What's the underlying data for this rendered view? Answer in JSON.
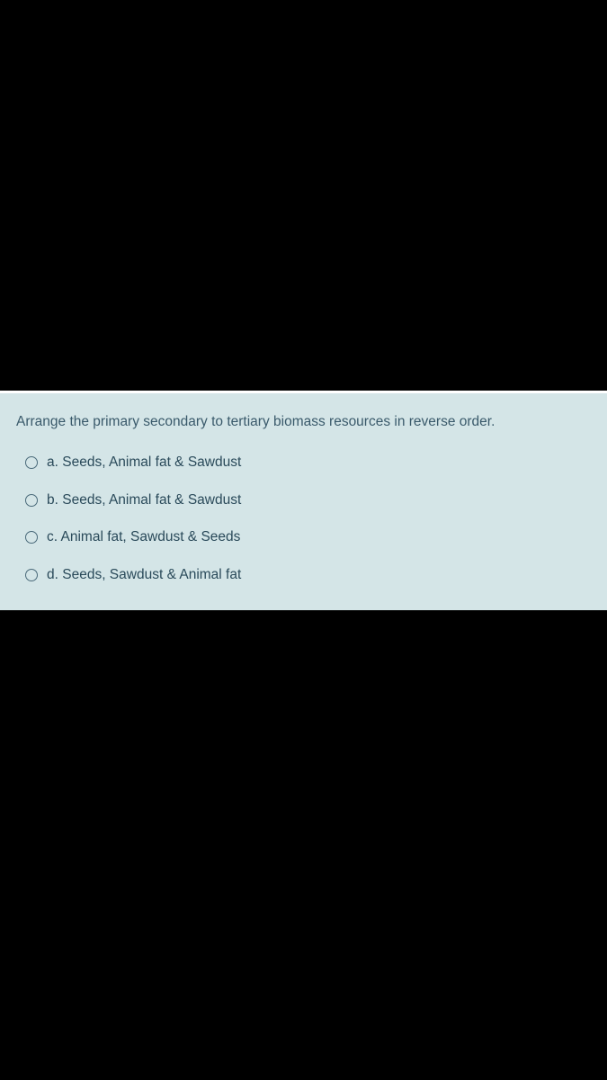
{
  "question": {
    "text": "Arrange the primary secondary to tertiary biomass resources in reverse order.",
    "options": [
      {
        "letter": "a.",
        "text": "Seeds, Animal fat & Sawdust"
      },
      {
        "letter": "b.",
        "text": "Seeds, Animal fat & Sawdust"
      },
      {
        "letter": "c.",
        "text": "Animal fat, Sawdust & Seeds"
      },
      {
        "letter": "d.",
        "text": "Seeds, Sawdust & Animal fat"
      }
    ]
  }
}
